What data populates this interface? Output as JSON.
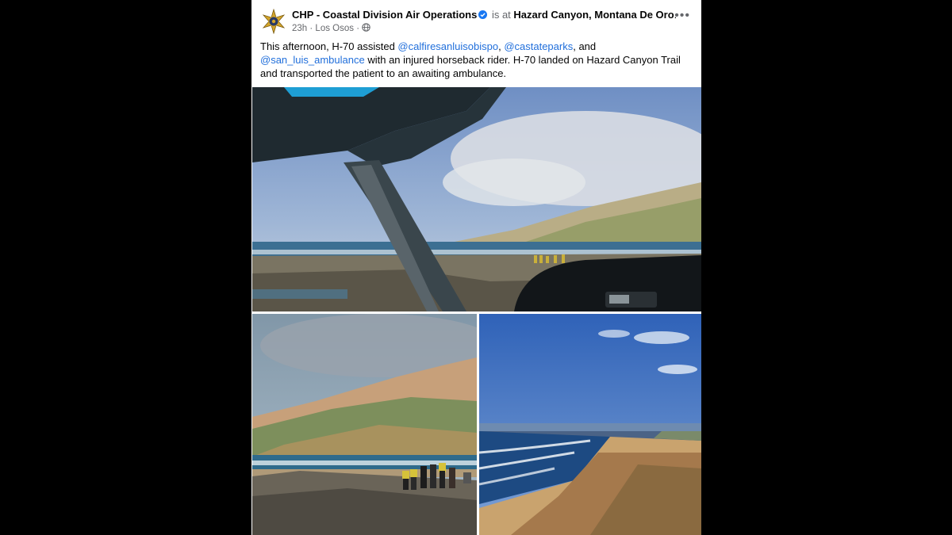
{
  "post": {
    "author": "CHP - Coastal Division Air Operations",
    "is_at": "is at",
    "location": "Hazard Canyon, Montana De Oro",
    "location_period": ".",
    "time": "23h",
    "sep1": " · ",
    "place": "Los Osos",
    "sep2": " · ",
    "more_label": "•••",
    "text_1": "This afternoon, H-70 assisted ",
    "mention_1": "@calfiresanluisobispo",
    "text_2": ", ",
    "mention_2": "@castateparks",
    "text_3": ", and ",
    "mention_3": "@san_luis_ambulance",
    "text_4": " with an injured horseback rider. H-70 landed on Hazard Canyon Trail and transported the patient to an awaiting ambulance."
  },
  "icons": {
    "avatar": "chp-star-badge-icon",
    "verified": "verified-badge-icon",
    "audience": "globe-icon",
    "more": "more-options-icon"
  },
  "colors": {
    "mention": "#216fdb",
    "muted": "#65676b",
    "verified": "#1877f2"
  }
}
